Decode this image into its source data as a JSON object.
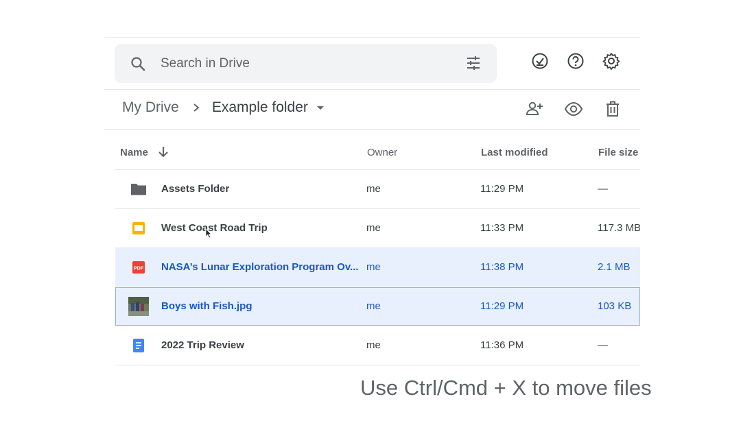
{
  "search": {
    "placeholder": "Search in Drive"
  },
  "icons": {
    "search": "search-icon",
    "filter": "tune-icon",
    "ready_offline": "check-circle-icon",
    "help": "help-icon",
    "settings": "gear-icon",
    "share": "add-person-icon",
    "preview": "eye-icon",
    "delete": "trash-icon"
  },
  "breadcrumb": {
    "root": "My Drive",
    "current": "Example folder"
  },
  "table": {
    "columns": {
      "name": "Name",
      "owner": "Owner",
      "modified": "Last modified",
      "size": "File size"
    },
    "rows": [
      {
        "name": "Assets Folder",
        "owner": "me",
        "modified": "11:29 PM",
        "size": "—",
        "icon": "folder-icon",
        "selected": false
      },
      {
        "name": "West Coast Road Trip",
        "owner": "me",
        "modified": "11:33 PM",
        "size": "117.3 MB",
        "icon": "slides-icon",
        "selected": false
      },
      {
        "name": "NASA’s Lunar Exploration Program Ov...",
        "owner": "me",
        "modified": "11:38 PM",
        "size": "2.1 MB",
        "icon": "pdf-icon",
        "selected": true
      },
      {
        "name": "Boys with Fish.jpg",
        "owner": "me",
        "modified": "11:29 PM",
        "size": "103 KB",
        "icon": "image-thumbnail",
        "selected": true
      },
      {
        "name": "2022 Trip Review",
        "owner": "me",
        "modified": "11:36 PM",
        "size": "—",
        "icon": "docs-icon",
        "selected": false
      }
    ]
  },
  "pdf_badge": "PDF",
  "caption": "Use Ctrl/Cmd + X to move files",
  "colors": {
    "selected_bg": "#e8f0fe",
    "selected_text": "#1a57c4",
    "folder": "#5f6368",
    "slides": "#f4b400",
    "pdf": "#ea4335",
    "docs": "#4285f4"
  }
}
